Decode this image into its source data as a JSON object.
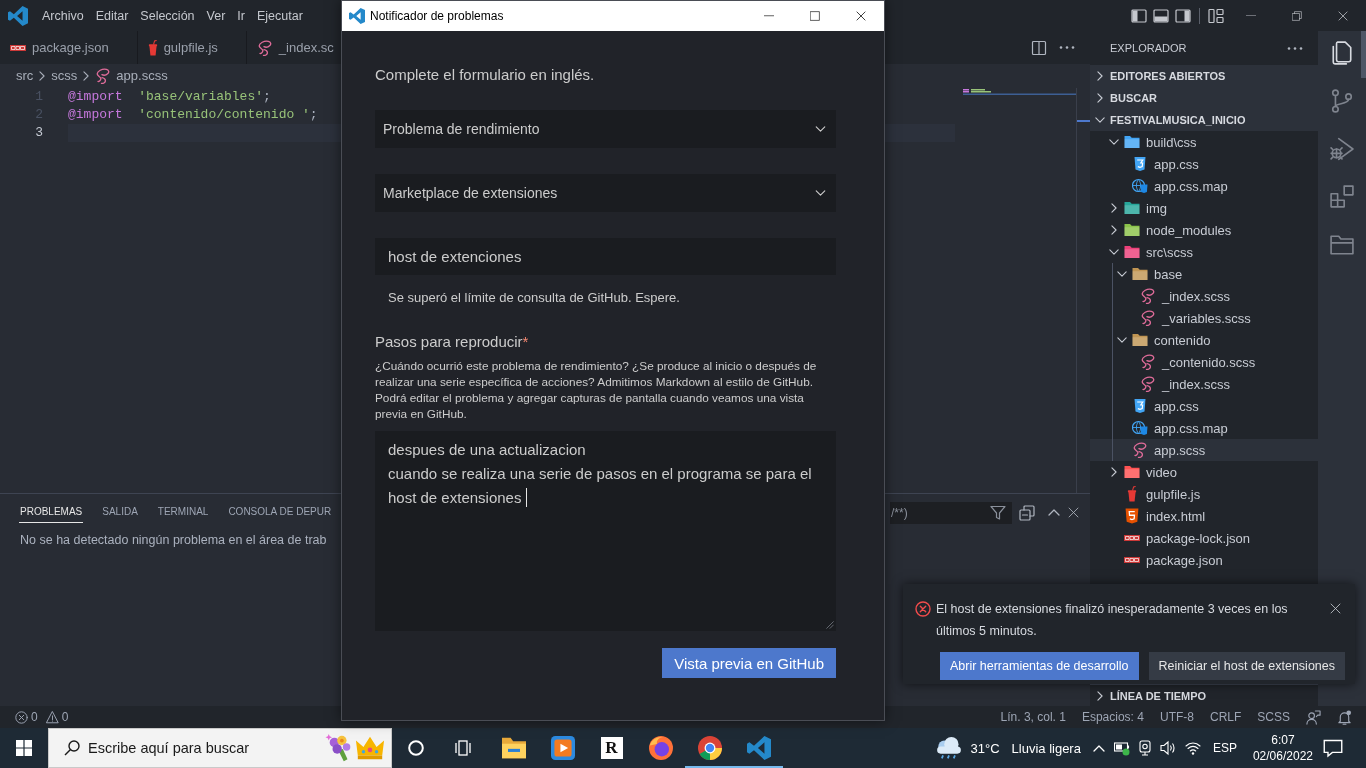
{
  "vscode_window": {
    "menu": [
      "Archivo",
      "Editar",
      "Selección",
      "Ver",
      "Ir",
      "Ejecutar"
    ]
  },
  "editor_tabs": [
    {
      "label": "package.json",
      "kind": "npm",
      "selected": false
    },
    {
      "label": "gulpfile.js",
      "kind": "gulp",
      "selected": false
    },
    {
      "label": "_index.sc",
      "kind": "sass",
      "selected": false
    }
  ],
  "breadcrumb": [
    {
      "label": "src",
      "kind": "folder"
    },
    {
      "label": "scss",
      "kind": "folder"
    },
    {
      "label": "app.scss",
      "kind": "sass"
    }
  ],
  "code_lines": [
    {
      "number": "1",
      "current": false,
      "tokens": [
        {
          "kind": "keyword",
          "text": "@import"
        },
        {
          "kind": "string",
          "text": "'base/variables'"
        },
        {
          "kind": "punctuation",
          "text": ";"
        }
      ]
    },
    {
      "number": "2",
      "current": false,
      "tokens": [
        {
          "kind": "keyword",
          "text": "@import"
        },
        {
          "kind": "string",
          "text": "'contenido/contenido '"
        },
        {
          "kind": "punctuation",
          "text": ";"
        }
      ]
    },
    {
      "number": "3",
      "current": true
    }
  ],
  "panel": {
    "tabs": [
      {
        "label": "PROBLEMAS",
        "selected": true
      },
      {
        "label": "SALIDA",
        "selected": false
      },
      {
        "label": "TERMINAL",
        "selected": false
      },
      {
        "label": "CONSOLA DE DEPUR",
        "selected": false
      }
    ],
    "filter": {
      "placeholder": "/**)"
    },
    "message": "No se ha detectado ningún problema en el área de trab"
  },
  "explorer": {
    "title": "EXPLORADOR",
    "sections": [
      {
        "label": "EDITORES ABIERTOS",
        "expanded": false
      },
      {
        "label": "BUSCAR",
        "expanded": false
      },
      {
        "label": "FESTIVALMUSICA_INICIO",
        "expanded": true,
        "tree": [
          {
            "label": "build\\css",
            "kind": "folder-css",
            "expanded": true,
            "selected": false,
            "children": [
              {
                "label": "app.css",
                "kind": "css",
                "selected": false
              },
              {
                "label": "app.css.map",
                "kind": "css-map",
                "selected": false
              }
            ]
          },
          {
            "label": "img",
            "kind": "folder-images",
            "expanded": false,
            "selected": false
          },
          {
            "label": "node_modules",
            "kind": "folder-node",
            "expanded": false,
            "selected": false
          },
          {
            "label": "src\\scss",
            "kind": "folder-sass",
            "expanded": true,
            "selected": false,
            "children": [
              {
                "label": "base",
                "kind": "folder",
                "expanded": true,
                "selected": false,
                "children": [
                  {
                    "label": "_index.scss",
                    "kind": "sass",
                    "selected": false
                  },
                  {
                    "label": "_variables.scss",
                    "kind": "sass",
                    "selected": false
                  }
                ]
              },
              {
                "label": "contenido",
                "kind": "folder",
                "expanded": true,
                "selected": false,
                "children": [
                  {
                    "label": "_contenido.scss",
                    "kind": "sass",
                    "selected": false
                  },
                  {
                    "label": "_index.scss",
                    "kind": "sass",
                    "selected": false
                  }
                ]
              },
              {
                "label": "app.css",
                "kind": "css",
                "selected": false
              },
              {
                "label": "app.css.map",
                "kind": "css-map",
                "selected": false
              },
              {
                "label": "app.scss",
                "kind": "sass",
                "selected": true
              }
            ]
          },
          {
            "label": "video",
            "kind": "folder-video",
            "expanded": false,
            "selected": false
          },
          {
            "label": "gulpfile.js",
            "kind": "gulp",
            "selected": false
          },
          {
            "label": "index.html",
            "kind": "html",
            "selected": false
          },
          {
            "label": "package-lock.json",
            "kind": "npm",
            "selected": false
          },
          {
            "label": "package.json",
            "kind": "npm",
            "selected": false
          }
        ]
      },
      {
        "label": "LÍNEA DE TIEMPO",
        "expanded": false
      }
    ]
  },
  "activity_bar": [
    {
      "kind": "files",
      "selected": true
    },
    {
      "kind": "source-control",
      "selected": false
    },
    {
      "kind": "run-debug",
      "selected": false
    },
    {
      "kind": "extensions",
      "selected": false
    },
    {
      "kind": "remote-explorer",
      "selected": false
    }
  ],
  "status_bar": {
    "errors": "0",
    "warnings": "0",
    "items": [
      "Lín. 3, col. 1",
      "Espacios: 4",
      "UTF-8",
      "CRLF",
      "SCSS"
    ]
  },
  "issue_reporter": {
    "title": "Notificador de problemas",
    "intro": "Complete el formulario en inglés.",
    "selects": [
      {
        "value": "Problema de rendimiento"
      },
      {
        "value": "Marketplace de extensiones"
      }
    ],
    "title_input": {
      "value": "host de extenciones"
    },
    "notice": "Se superó el límite de consulta de GitHub. Espere.",
    "steps": {
      "label": "Pasos para reproducir",
      "required_mark": "*",
      "description": "¿Cuándo ocurrió este problema de rendimiento? ¿Se produce al inicio o después de realizar una serie específica de acciones? Admitimos Markdown al estilo de GitHub. Podrá editar el problema y agregar capturas de pantalla cuando veamos una vista previa en GitHub.",
      "value": [
        "despues de una actualizacion",
        "cuando se realiza una serie de pasos en el programa se para el host de extensiones"
      ]
    },
    "preview_button": "Vista previa en GitHub"
  },
  "notification": {
    "message": "El host de extensiones finalizó inesperadamente 3 veces en los últimos 5 minutos.",
    "buttons": [
      {
        "label": "Abrir herramientas de desarrollo",
        "primary": true
      },
      {
        "label": "Reiniciar el host de extensiones",
        "primary": false
      }
    ]
  },
  "taskbar": {
    "search": {
      "placeholder": "Escribe aquí para buscar"
    },
    "apps": [
      {
        "kind": "file-explorer",
        "running": false
      },
      {
        "kind": "media-player",
        "running": false
      },
      {
        "kind": "letter-app",
        "glyph": "R",
        "running": false
      },
      {
        "kind": "firefox",
        "running": false
      },
      {
        "kind": "chrome",
        "running": true
      },
      {
        "kind": "vscode",
        "running": true
      }
    ],
    "weather": {
      "temperature": "31°C",
      "condition": "Lluvia ligera"
    },
    "language": "ESP",
    "time": "6:07",
    "date": "02/06/2022"
  }
}
